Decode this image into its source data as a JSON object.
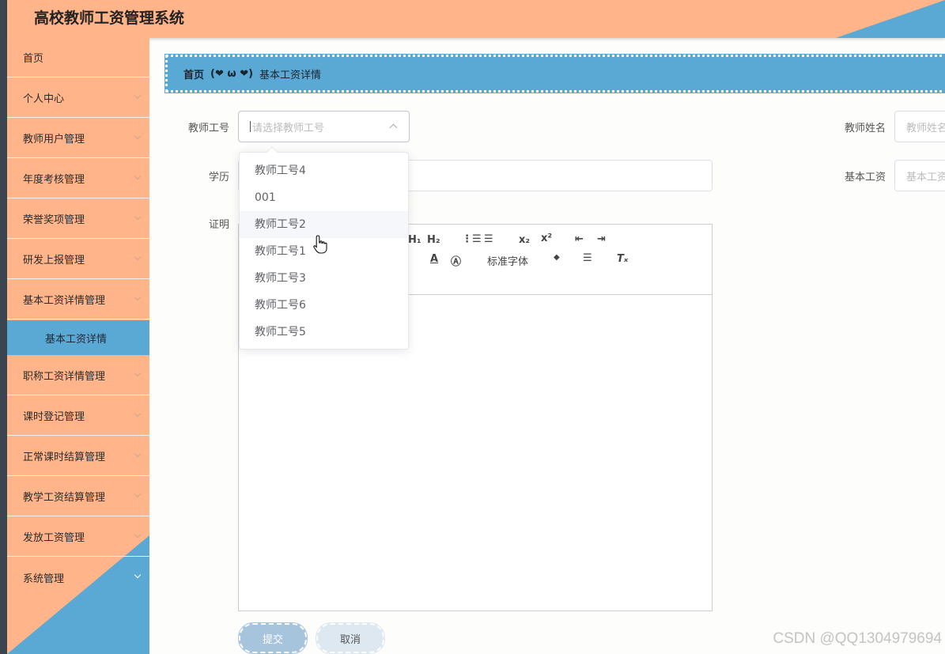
{
  "app": {
    "title": "高校教师工资管理系统"
  },
  "sidebar": {
    "items": [
      {
        "label": "首页",
        "chevron": false
      },
      {
        "label": "个人中心",
        "chevron": true
      },
      {
        "label": "教师用户管理",
        "chevron": true
      },
      {
        "label": "年度考核管理",
        "chevron": true
      },
      {
        "label": "荣誉奖项管理",
        "chevron": true
      },
      {
        "label": "研发上报管理",
        "chevron": true
      },
      {
        "label": "基本工资详情管理",
        "chevron": true
      },
      {
        "label": "职称工资详情管理",
        "chevron": true
      },
      {
        "label": "课时登记管理",
        "chevron": true
      },
      {
        "label": "正常课时结算管理",
        "chevron": true
      },
      {
        "label": "教学工资结算管理",
        "chevron": true
      },
      {
        "label": "发放工资管理",
        "chevron": true
      },
      {
        "label": "系统管理",
        "chevron": true
      }
    ],
    "active_sub": "基本工资详情"
  },
  "breadcrumb": {
    "home": "首页",
    "separator": "(❤ ω ❤)",
    "current": "基本工资详情"
  },
  "form": {
    "teacher_id_label": "教师工号",
    "teacher_id_placeholder": "请选择教师工号",
    "teacher_name_label": "教师姓名",
    "teacher_name_placeholder": "教师姓名",
    "education_label": "学历",
    "base_salary_label": "基本工资",
    "base_salary_placeholder": "基本工资",
    "proof_label": "证明"
  },
  "dropdown": {
    "options": [
      "教师工号4",
      "001",
      "教师工号2",
      "教师工号1",
      "教师工号3",
      "教师工号6",
      "教师工号5"
    ],
    "hovered": "教师工号2"
  },
  "editor": {
    "font_select": "标准字体"
  },
  "buttons": {
    "submit": "提交",
    "cancel": "取消"
  },
  "watermark": "CSDN @QQ1304979694",
  "colors": {
    "orange": "#ffb48a",
    "blue": "#5aa9d4"
  }
}
